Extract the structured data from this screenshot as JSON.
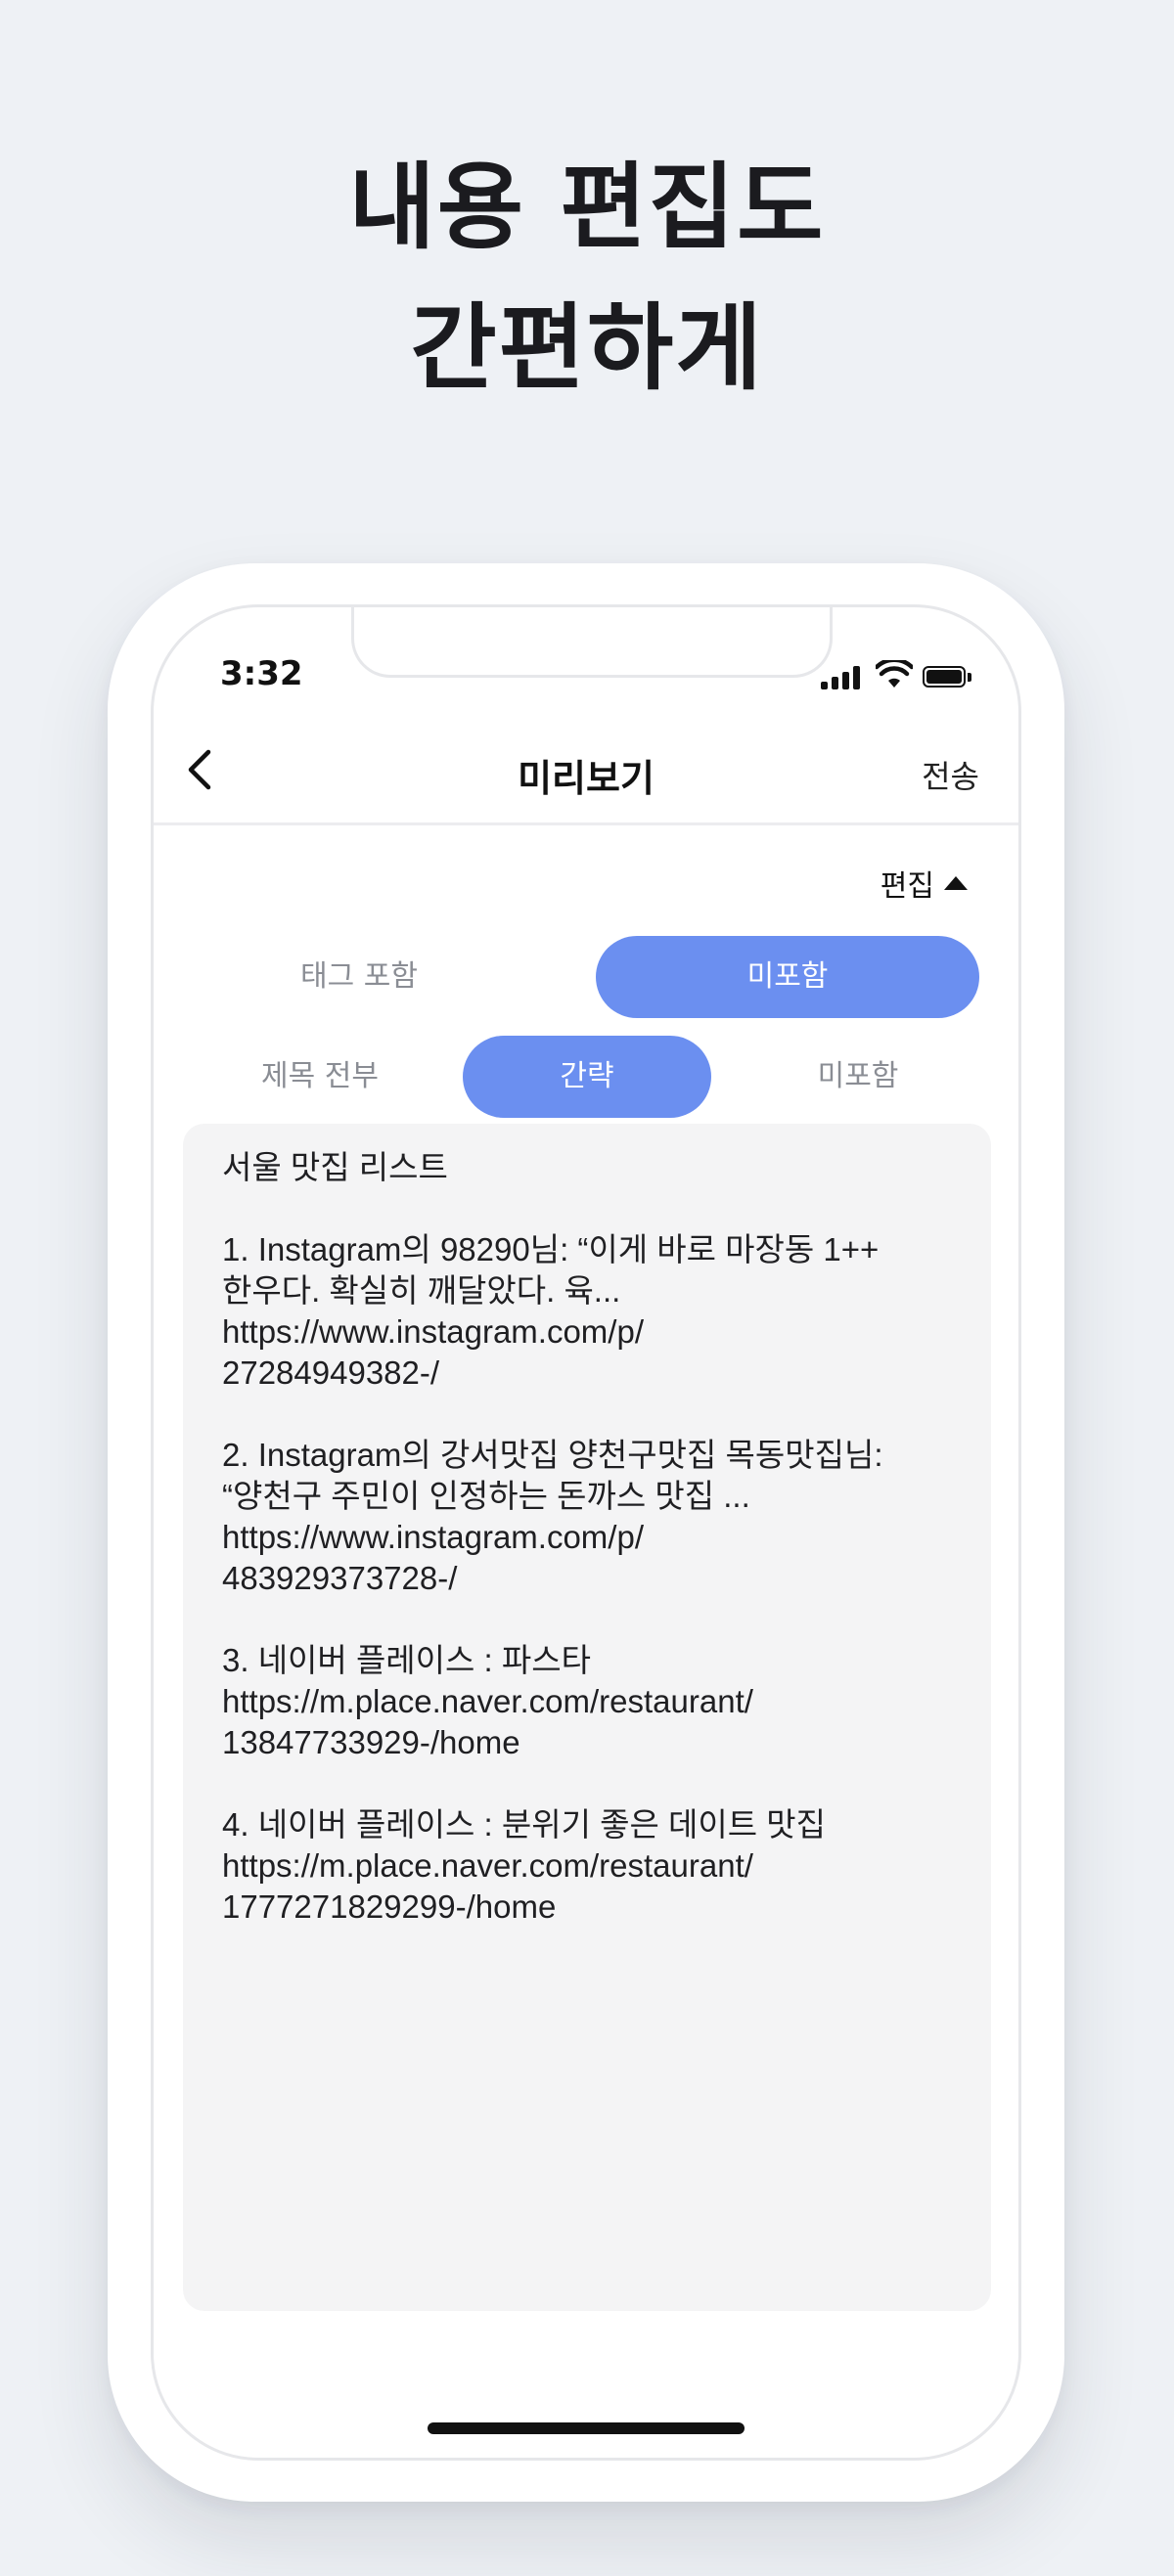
{
  "headline": {
    "line1": "내용 편집도",
    "line2": "간편하게"
  },
  "status_bar": {
    "time": "3:32",
    "icons": [
      "signal-icon",
      "wifi-icon",
      "battery-icon"
    ]
  },
  "nav": {
    "back_icon": "chevron-left-icon",
    "title": "미리보기",
    "send_label": "전송"
  },
  "edit": {
    "label": "편집",
    "icon": "caret-up-icon"
  },
  "tag_options": [
    {
      "label": "태그 포함",
      "selected": false
    },
    {
      "label": "미포함",
      "selected": true
    }
  ],
  "title_options": [
    {
      "label": "제목 전부",
      "selected": false
    },
    {
      "label": "간략",
      "selected": true
    },
    {
      "label": "미포함",
      "selected": false
    }
  ],
  "preview": {
    "title": "서울 맛집 리스트",
    "items": [
      "1.  Instagram의 98290님: “이게 바로 마장동 1++\n한우다. 확실히 깨달았다. 육...\nhttps://www.instagram.com/p/\n27284949382-/",
      "2.  Instagram의 강서맛집 양천구맛집 목동맛집님:\n“양천구 주민이 인정하는 돈까스 맛집 ...\nhttps://www.instagram.com/p/\n483929373728-/",
      "3.  네이버 플레이스 : 파스타\nhttps://m.place.naver.com/restaurant/\n13847733929-/home",
      "4.  네이버 플레이스 : 분위기 좋은 데이트 맛집\nhttps://m.place.naver.com/restaurant/\n1777271829299-/home"
    ]
  },
  "colors": {
    "background": "#eef1f5",
    "accent": "#6b8ff0",
    "preview_bg": "#f4f4f5"
  }
}
